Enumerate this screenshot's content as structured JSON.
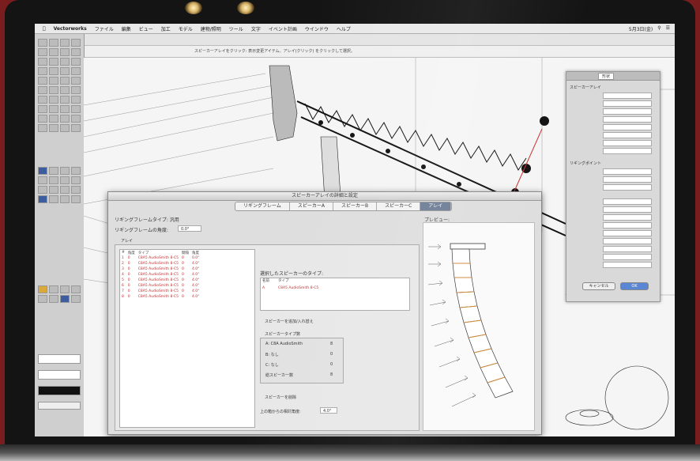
{
  "app": {
    "name": "Vectorworks",
    "menus": [
      "ファイル",
      "編集",
      "ビュー",
      "加工",
      "モデル",
      "建物/照明",
      "ツール",
      "文字",
      "イベント計画",
      "ウインドウ",
      "ヘルプ"
    ],
    "clock": "5月3日(金)"
  },
  "infobar": {
    "hint": "スピーカーアレイをクリック: 表示変更アイテム、アレイ(クリック) をクリックして選択。"
  },
  "object_info": {
    "tabs": [
      "形状"
    ],
    "section_speaker_array": "スピーカーアレイ",
    "section_rigging": "リギングポイント",
    "buttons": {
      "cancel": "キャンセル",
      "ok": "OK"
    }
  },
  "dialog": {
    "title": "スピーカーアレイの詳細と設定",
    "tabs": [
      {
        "label": "リギングフレーム",
        "active": false
      },
      {
        "label": "スピーカーA",
        "active": false
      },
      {
        "label": "スピーカーB",
        "active": false
      },
      {
        "label": "スピーカーC",
        "active": false
      },
      {
        "label": "アレイ",
        "active": true
      }
    ],
    "rigging_type_label": "リギングフレームタイプ: 汎用",
    "rigging_angle_label": "リギングフレームの角度:",
    "rigging_angle_value": "0.0°",
    "array_group_label": "アレイ",
    "table": {
      "headers": [
        "#",
        "角度",
        "タイプ",
        "間隔",
        "角度"
      ],
      "rows": [
        [
          "1",
          "0",
          "C8A5 AudioSmith 8-C5",
          "0",
          "0.0°"
        ],
        [
          "2",
          "0",
          "C8A5 AudioSmith 8-C5",
          "0",
          "4.0°"
        ],
        [
          "3",
          "0",
          "C8A5 AudioSmith 8-C5",
          "0",
          "4.0°"
        ],
        [
          "4",
          "0",
          "C8A5 AudioSmith 8-C5",
          "0",
          "4.0°"
        ],
        [
          "5",
          "0",
          "C8A5 AudioSmith 8-C5",
          "0",
          "4.0°"
        ],
        [
          "6",
          "0",
          "C8A5 AudioSmith 8-C5",
          "0",
          "4.0°"
        ],
        [
          "7",
          "0",
          "C8A5 AudioSmith 8-C5",
          "0",
          "4.0°"
        ],
        [
          "8",
          "0",
          "C8A5 AudioSmith 8-C5",
          "0",
          "4.0°"
        ]
      ]
    },
    "selected_speaker_type_label": "選択したスピーカーのタイプ:",
    "speaker_list_header": [
      "名前",
      "タイプ"
    ],
    "speaker_list_row": [
      "A",
      "C8A5 AudioSmith 8-C5"
    ],
    "add_button": "スピーカーを追加/入れ替え",
    "count_header": "スピーカータイプ数",
    "counts": [
      {
        "label": "A: C8A AudioSmith",
        "value": "8"
      },
      {
        "label": "B: なし",
        "value": "0"
      },
      {
        "label": "C: なし",
        "value": "0"
      },
      {
        "label": "総スピーカー数",
        "value": "8"
      }
    ],
    "delete_button": "スピーカーを削除",
    "relative_angle_label": "上の箱からの相対角度:",
    "relative_angle_value": "4.0°",
    "preview_label": "プレビュー:"
  }
}
